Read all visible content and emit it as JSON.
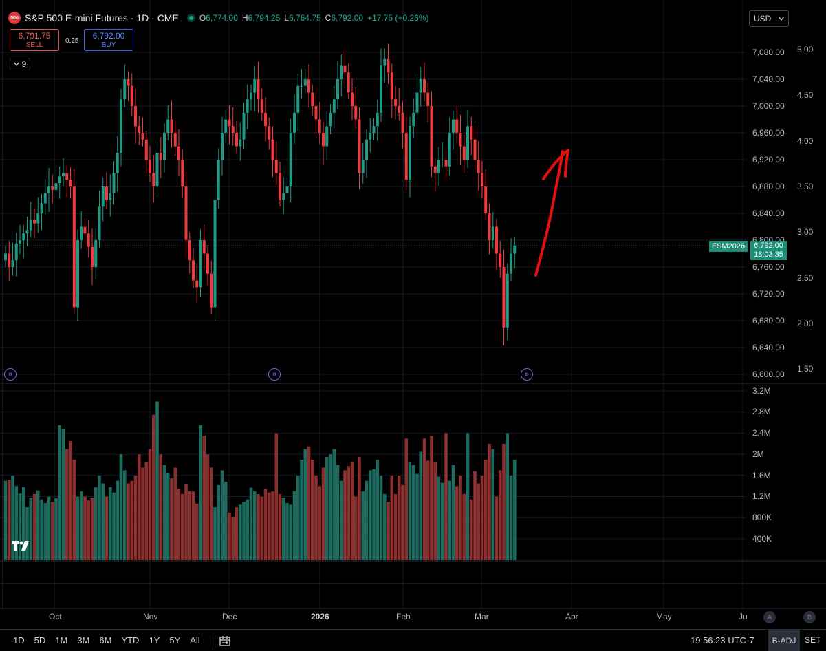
{
  "header": {
    "logo_text": "500",
    "title": "S&P 500 E-mini Futures · 1D · CME",
    "ohlc": [
      {
        "label": "O",
        "value": "6,774.00"
      },
      {
        "label": "H",
        "value": "6,794.25"
      },
      {
        "label": "L",
        "value": "6,764.75"
      },
      {
        "label": "C",
        "value": "6,792.00"
      }
    ],
    "change": "+17.75 (+0.26%)"
  },
  "trade": {
    "sell_price": "6,791.75",
    "sell_label": "SELL",
    "spread": "0.25",
    "buy_price": "6,792.00",
    "buy_label": "BUY"
  },
  "indicators_count": "9",
  "currency": "USD",
  "price_axis": [
    "7,080.00",
    "7,040.00",
    "7,000.00",
    "6,960.00",
    "6,920.00",
    "6,880.00",
    "6,840.00",
    "6,800.00",
    "6,760.00",
    "6,720.00",
    "6,680.00",
    "6,640.00",
    "6,600.00"
  ],
  "pct_axis": [
    "5.00",
    "4.50",
    "4.00",
    "3.50",
    "3.00",
    "2.50",
    "2.00",
    "1.50"
  ],
  "volume_axis": [
    "3.2M",
    "2.8M",
    "2.4M",
    "2M",
    "1.6M",
    "1.2M",
    "800K",
    "400K"
  ],
  "time_axis": [
    "Oct",
    "Nov",
    "Dec",
    "2026",
    "Feb",
    "Mar",
    "Apr",
    "May",
    "Ju"
  ],
  "last_price": {
    "symbol": "ESM2026",
    "price": "6,792.00",
    "countdown": "18:03:35"
  },
  "event_icon_glyph": "»",
  "axis_buttons": [
    "A",
    "B"
  ],
  "toolbar": {
    "ranges": [
      "1D",
      "5D",
      "1M",
      "3M",
      "6M",
      "YTD",
      "1Y",
      "5Y",
      "All"
    ],
    "clock": "19:56:23 UTC-7",
    "adjustment": "B-ADJ",
    "session": "SET"
  },
  "colors": {
    "up": "#1f9a84",
    "down": "#ef3b3b",
    "vol_up": "#1d6b5f",
    "vol_down": "#8c2f2f",
    "annotation": "#e31010"
  },
  "chart_data": {
    "type": "candlestick",
    "series_name": "S&P 500 E-mini Futures",
    "ylim": [
      6600,
      7100
    ],
    "volume_ylim": [
      0,
      3200000
    ],
    "x_range_labels": [
      "Oct",
      "Nov",
      "Dec",
      "2026",
      "Feb",
      "Mar",
      "Apr",
      "May",
      "Ju"
    ],
    "closes": [
      6780,
      6760,
      6770,
      6795,
      6800,
      6810,
      6815,
      6830,
      6825,
      6840,
      6855,
      6870,
      6880,
      6875,
      6885,
      6895,
      6900,
      6890,
      6880,
      6700,
      6800,
      6820,
      6810,
      6790,
      6760,
      6800,
      6850,
      6880,
      6860,
      6870,
      6900,
      6930,
      7010,
      7040,
      7030,
      7000,
      6970,
      6960,
      6950,
      6920,
      6900,
      6880,
      6930,
      6920,
      6960,
      6980,
      6960,
      6940,
      6920,
      6880,
      6800,
      6770,
      6740,
      6730,
      6800,
      6780,
      6750,
      6700,
      6860,
      6920,
      6960,
      6980,
      6970,
      6960,
      6940,
      6950,
      6990,
      7010,
      7020,
      7040,
      7010,
      6990,
      6970,
      6950,
      6920,
      6900,
      6860,
      6870,
      6880,
      6960,
      6990,
      7030,
      7030,
      7040,
      7020,
      7000,
      6980,
      6960,
      6940,
      6970,
      6990,
      7010,
      7040,
      7060,
      7050,
      7020,
      7000,
      6980,
      6900,
      6920,
      6950,
      6960,
      6970,
      6990,
      7060,
      7070,
      7050,
      7010,
      7000,
      6990,
      6960,
      6890,
      6970,
      6990,
      7020,
      7040,
      7020,
      7000,
      6910,
      6900,
      6920,
      6920,
      6910,
      6960,
      6980,
      6960,
      6940,
      6920,
      6970,
      6950,
      6920,
      6900,
      6880,
      6840,
      6800,
      6820,
      6780,
      6760,
      6670,
      6750,
      6780,
      6792
    ],
    "volumes": [
      1500000,
      1520000,
      1600000,
      1400000,
      1260000,
      1380000,
      1000000,
      1180000,
      1250000,
      1320000,
      1150000,
      1080000,
      1200000,
      1100000,
      1170000,
      2550000,
      2480000,
      2100000,
      2250000,
      1900000,
      1200000,
      1300000,
      1200000,
      1130000,
      1180000,
      1380000,
      1600000,
      1450000,
      1200000,
      1380000,
      1280000,
      1500000,
      2000000,
      1700000,
      1450000,
      1500000,
      1600000,
      2000000,
      1750000,
      1850000,
      2100000,
      2750000,
      3000000,
      2000000,
      1800000,
      1650000,
      1550000,
      1750000,
      1350000,
      1250000,
      1430000,
      1300000,
      1300000,
      1070000,
      2550000,
      2350000,
      2000000,
      1750000,
      1000000,
      1420000,
      1700000,
      1480000,
      900000,
      820000,
      1000000,
      1050000,
      1100000,
      1150000,
      1370000,
      1300000,
      1250000,
      1200000,
      1350000,
      1280000,
      1300000,
      2400000,
      1250000,
      1180000,
      1080000,
      1050000,
      1300000,
      1600000,
      1900000,
      2100000,
      2150000,
      1900000,
      1600000,
      1400000,
      1750000,
      1950000,
      2000000,
      2100000,
      1800000,
      1500000,
      1700000,
      1780000,
      1860000,
      1200000,
      1950000,
      1300000,
      1500000,
      1700000,
      1720000,
      1900000,
      1600000,
      1250000,
      1100000,
      1600000,
      1250000,
      1600000,
      1420000,
      2300000,
      1850000,
      1800000,
      1630000,
      2050000,
      2300000,
      1880000,
      2350000,
      1850000,
      1580000,
      1460000,
      2400000,
      1500000,
      1800000,
      1400000,
      1600000,
      1250000,
      2400000,
      1150000,
      1680000,
      1450000,
      1600000,
      1900000,
      2200000,
      2100000,
      1200000,
      1700000,
      2200000,
      2400000,
      1600000,
      1900000,
      20000,
      20000
    ]
  }
}
